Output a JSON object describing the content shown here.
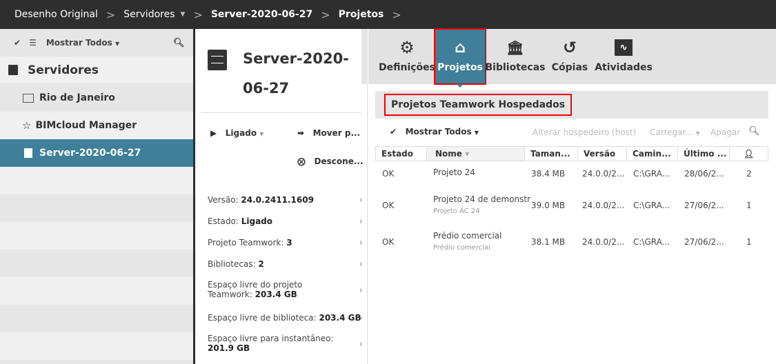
{
  "breadcrumb": [
    "Desenho Original",
    "Servidores",
    "Server-2020-06-27",
    "Projetos"
  ],
  "sidebar": {
    "filter_label": "Mostrar Todos",
    "heading": "Servidores",
    "items": [
      {
        "label": "Rio de Janeiro"
      },
      {
        "label": "BIMcloud Manager"
      },
      {
        "label": "Server-2020-06-27"
      }
    ]
  },
  "server": {
    "title_line1": "Server-2020-",
    "title_line2": "06-27",
    "status_action": "Ligado",
    "move_action": "Mover p...",
    "disconnect_action": "Descone...",
    "info": [
      {
        "label": "Versão: ",
        "value": "24.0.2411.1609"
      },
      {
        "label": "Estado: ",
        "value": "Ligado"
      },
      {
        "label": "Projeto Teamwork: ",
        "value": "3"
      },
      {
        "label": "Bibliotecas: ",
        "value": "2"
      },
      {
        "label": "Espaço livre do projeto Teamwork: ",
        "value": "203.4 GB"
      },
      {
        "label": "Espaço livre de biblioteca: ",
        "value": "203.4 GB"
      },
      {
        "label": "Espaço livre para instantâneo: ",
        "value": "201.9 GB"
      }
    ]
  },
  "tabs": [
    {
      "label": "Definições"
    },
    {
      "label": "Projetos"
    },
    {
      "label": "Bibliotecas"
    },
    {
      "label": "Cópias"
    },
    {
      "label": "Atividades"
    }
  ],
  "section_title": "Projetos Teamwork Hospedados",
  "toolbar": {
    "filter": "Mostrar Todos",
    "change_host": "Alterar hospedeiro (host)",
    "load": "Carregar...",
    "delete": "Apagar"
  },
  "table": {
    "headers": [
      "Estado",
      "Nome",
      "Taman...",
      "Versão",
      "Camin...",
      "Último ..."
    ],
    "rows": [
      {
        "estado": "OK",
        "nome": "Projeto 24",
        "sub": "",
        "tamanho": "38.4 MB",
        "versao": "24.0.0/2...",
        "caminho": "C:\\GRA...",
        "ultimo": "28/06/2...",
        "users": "2"
      },
      {
        "estado": "OK",
        "nome": "Projeto 24 de demonstr",
        "sub": "Projeto AC 24",
        "tamanho": "39.0 MB",
        "versao": "24.0.0/2...",
        "caminho": "C:\\GRA...",
        "ultimo": "27/06/2...",
        "users": "1"
      },
      {
        "estado": "OK",
        "nome": "Prédio comercial",
        "sub": "Prédio comercial",
        "tamanho": "38.1 MB",
        "versao": "24.0.0/2...",
        "caminho": "C:\\GRA...",
        "ultimo": "27/06/2...",
        "users": "1"
      }
    ]
  },
  "colors": {
    "accent": "#3f7f99",
    "topbar": "#2e2e2e",
    "highlight": "#e00000"
  }
}
